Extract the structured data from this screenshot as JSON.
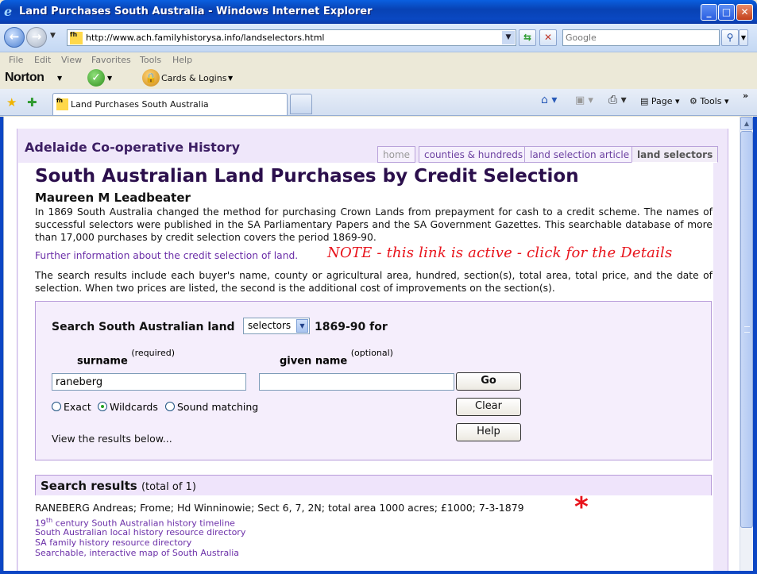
{
  "window": {
    "title": "Land Purchases South Australia - Windows Internet Explorer",
    "min": "_",
    "max": "□",
    "close": "✕"
  },
  "addressbar": {
    "url": "http://www.ach.familyhistorysa.info/landselectors.html",
    "search_placeholder": "Google",
    "favicon_text": "fh"
  },
  "menu": [
    "File",
    "Edit",
    "View",
    "Favorites",
    "Tools",
    "Help"
  ],
  "norton": {
    "logo": "Norton",
    "cards_label": "Cards & Logins"
  },
  "tabs": {
    "active_tab": "Land Purchases South Australia",
    "page_label": "Page",
    "tools_label": "Tools"
  },
  "site": {
    "title": "Adelaide Co-operative History",
    "nav": [
      "home",
      "counties & hundreds",
      "land selection article",
      "land selectors"
    ]
  },
  "article": {
    "heading": "South Australian Land Purchases by Credit Selection",
    "author": "Maureen M Leadbeater",
    "intro": "In 1869 South Australia changed the method for purchasing Crown Lands from prepayment for cash to a credit scheme. The names of successful selectors were published in the SA Parliamentary Papers and the SA Government Gazettes. This searchable database of more than 17,000 purchases by credit selection covers the period 1869-90.",
    "info_link": "Further information about the credit selection of land.",
    "note": "NOTE - this link is active - click for the Details",
    "results_desc": "The search results include each buyer's name, county or agricultural area, hundred, section(s), total area, total price, and the date of selection. When two prices are listed, the second is the additional cost of improvements on the section(s)."
  },
  "search": {
    "label": "Search South Australian land",
    "db_value": "selectors",
    "years": "1869-90 for",
    "surname_label": "surname",
    "surname_note": "(required)",
    "given_label": "given name",
    "given_note": "(optional)",
    "surname_value": "raneberg",
    "given_value": "",
    "go": "Go",
    "clear": "Clear",
    "help": "Help",
    "match_options": [
      "Exact",
      "Wildcards",
      "Sound matching"
    ],
    "selected_match": "Wildcards",
    "view_below": "View the results below..."
  },
  "results": {
    "title": "Search results",
    "total": "(total of 1)",
    "rows": [
      "RANEBERG Andreas; Frome; Hd Winninowie; Sect 6, 7, 2N; total area 1000 acres; £1000; 7-3-1879"
    ],
    "marker": "*"
  },
  "footer_links": {
    "timeline_prefix": "19",
    "timeline_sup": "th",
    "timeline_rest": " century South Australian history timeline",
    "local": "South Australian local history resource directory",
    "family": "SA family history resource directory",
    "map": "Searchable, interactive map of South Australia"
  },
  "icons": {
    "back": "back-arrow-icon",
    "forward": "forward-arrow-icon",
    "refresh": "refresh-icon",
    "stop": "stop-icon",
    "search": "search-icon",
    "favorites": "favorites-star-icon",
    "add_favorite": "add-favorite-icon",
    "home": "home-icon",
    "feeds": "feeds-icon",
    "print": "print-icon"
  },
  "colors": {
    "titlebar": "#0a48c2",
    "site_purple": "#3c1e63",
    "link": "#6b2fa8",
    "note_red": "#e8141c",
    "panel_bg": "#f5eefc"
  }
}
